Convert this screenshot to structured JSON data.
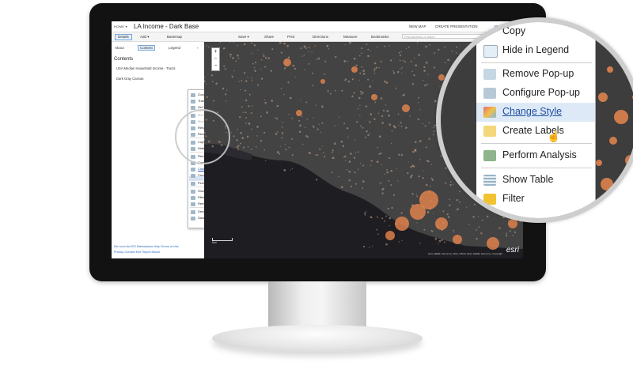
{
  "app": {
    "breadcrumb": "HOME ▾",
    "title": "LA Income - Dark Base",
    "new_map": "NEW MAP",
    "create_presentation": "CREATE PRESENTATION",
    "user": "Mark ▾"
  },
  "toolbar": {
    "details": "Details",
    "add": "Add ▾",
    "basemap": "Basemap",
    "save": "Save ▾",
    "share": "Share",
    "print": "Print",
    "directions": "Directions",
    "measure": "Measure",
    "bookmarks": "Bookmarks",
    "search_placeholder": "Find address or place"
  },
  "sidebar": {
    "tabs": [
      "About",
      "Content",
      "Legend"
    ],
    "heading": "Contents",
    "layers": [
      "USA Median Household Income - Tracts",
      "Dark Gray Canvas"
    ],
    "footer_line1": "Esri.com   ArcGIS Marketplace   Help   Terms of Use",
    "footer_line2": "Privacy   Contact Esri   Report Abuse"
  },
  "context_menu_small": [
    "Zoom to",
    "Transparency",
    "Set Visibility Range",
    "Move up",
    "Move down",
    "Rename",
    "Remove",
    "Copy",
    "Hide in Legend",
    "Remove Pop-up",
    "Configure Pop-up",
    "Change Style",
    "Create Labels",
    "Perform Analysis",
    "Show Table",
    "Filter",
    "Remove Filter",
    "Description",
    "Save Layer"
  ],
  "magnifier_menu": {
    "copy": "Copy",
    "hide_in_legend": "Hide in Legend",
    "remove_popup": "Remove Pop-up",
    "configure_popup": "Configure Pop-up",
    "change_style": "Change Style",
    "create_labels": "Create Labels",
    "perform_analysis": "Perform Analysis",
    "show_table": "Show Table",
    "filter": "Filter"
  },
  "map": {
    "scale": "5mi",
    "attribution": "Esri, HERE, DeLorme, NGA, USGS | Esri, HERE, DeLorme, Copyright",
    "logo": "esri",
    "zoom_in": "+",
    "zoom_out": "−"
  },
  "colors": {
    "bezel": "#121212",
    "map_land": "#434343",
    "ocean": "#1e1d22",
    "dots": "#e8864d",
    "accent": "#2a6cc0"
  }
}
